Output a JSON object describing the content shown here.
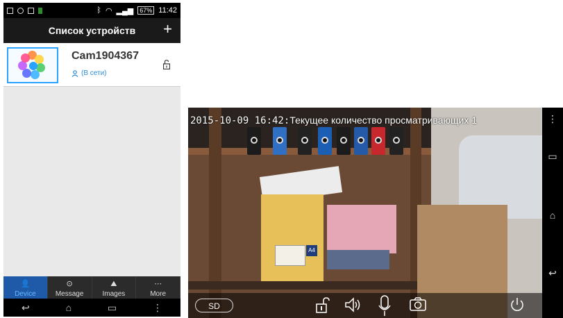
{
  "phone_left": {
    "status_bar": {
      "battery": "67%",
      "time": "11:42"
    },
    "title": "Список устройств",
    "add_label": "+",
    "device": {
      "name": "Cam1904367",
      "status": "(В сети)"
    },
    "tabs": [
      {
        "label": "Device",
        "icon": "person-icon"
      },
      {
        "label": "Message",
        "icon": "chat-bubble-icon"
      },
      {
        "label": "Images",
        "icon": "mountain-image-icon"
      },
      {
        "label": "More",
        "icon": "dots-icon"
      }
    ]
  },
  "phone_right": {
    "osd_timestamp": "2015-10-09  16:42:",
    "osd_viewers": "Текущее количество просматривающих 1",
    "sd_label": "SD"
  }
}
